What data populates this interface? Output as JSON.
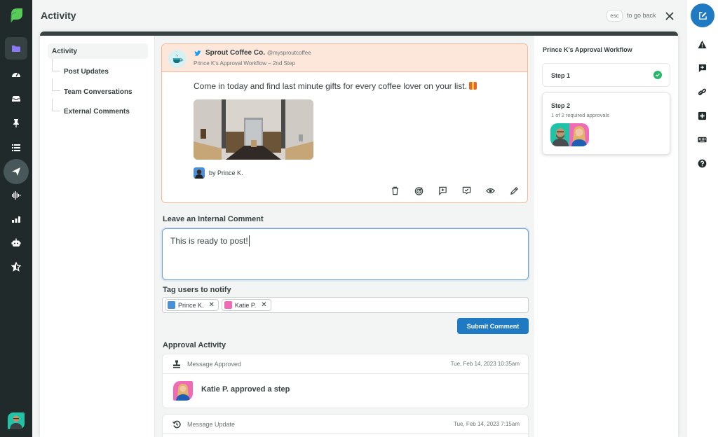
{
  "header": {
    "title": "Activity",
    "esc_key": "esc",
    "go_back": "to go back"
  },
  "leftnav": {
    "items": [
      "folder-icon",
      "dashboard-icon",
      "inbox-icon",
      "pin-icon",
      "list-icon",
      "send-icon",
      "listening-icon",
      "reports-icon",
      "bot-icon",
      "reviews-icon"
    ],
    "active": "folder-icon"
  },
  "rightrail": {
    "items": [
      "compose-icon",
      "alert-icon",
      "add-comment-icon",
      "link-icon",
      "add-icon",
      "keyboard-icon",
      "help-icon"
    ]
  },
  "side_menu": {
    "active": "Activity",
    "items": [
      "Post Updates",
      "Team Conversations",
      "External Comments"
    ]
  },
  "post": {
    "brand_name": "Sprout Coffee Co.",
    "handle": "@mysproutcoffee",
    "workflow_step": "Prince K's Approval Workflow – 2nd Step",
    "text": "Come in today and find last minute gifts for every coffee lover on your list.",
    "author": "by Prince K.",
    "actions": [
      "delete-icon",
      "target-icon",
      "add-note-icon",
      "approve-comment-icon",
      "preview-icon",
      "edit-icon"
    ]
  },
  "comment": {
    "label": "Leave an Internal Comment",
    "value": "This is ready to post!"
  },
  "tags": {
    "label": "Tag users to notify",
    "users": [
      "Prince K.",
      "Katie P."
    ]
  },
  "submit_label": "Submit Comment",
  "approval_activity": {
    "label": "Approval Activity",
    "entries": [
      {
        "type": "Message Approved",
        "timestamp": "Tue, Feb 14, 2023 10:35am",
        "text": "Katie P. approved a step"
      },
      {
        "type": "Message Update",
        "timestamp": "Tue, Feb 14, 2023 7:15am"
      }
    ]
  },
  "workflow": {
    "title": "Prince K's Approval Workflow",
    "steps": [
      {
        "name": "Step 1",
        "status": "complete"
      },
      {
        "name": "Step 2",
        "sub": "1 of 2 required approvals",
        "approvers": [
          "Prince K.",
          "Katie P."
        ]
      }
    ]
  },
  "colors": {
    "brand_green": "#59cb59",
    "primary_blue": "#2079c3",
    "nav_bg": "#202a2b",
    "active_folder": "#8b79f5",
    "post_header_bg": "#fde6da",
    "success": "#26b76b"
  }
}
